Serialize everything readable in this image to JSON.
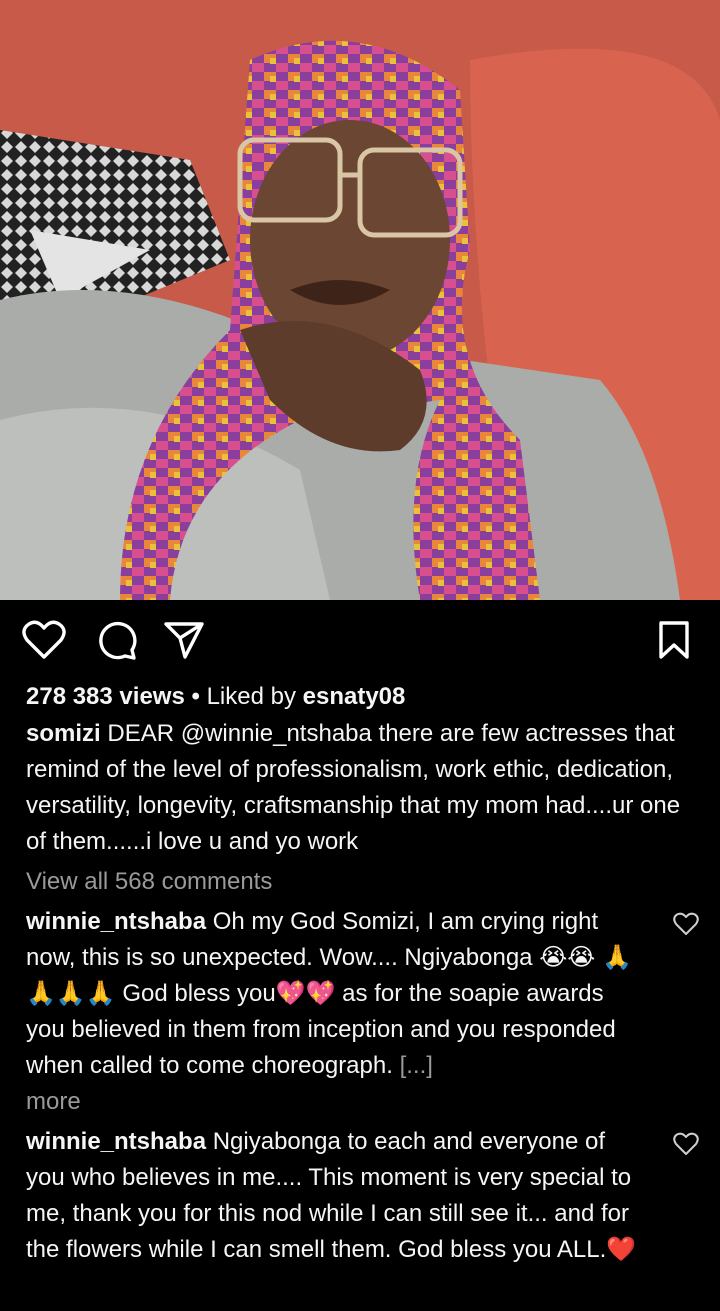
{
  "post": {
    "views": "278 383 views",
    "separator": "•",
    "liked_prefix": "Liked by",
    "liked_user": "esnaty08",
    "caption_user": "somizi",
    "caption_text": "DEAR @winnie_ntshaba there are few actresses that remind of the level of professionalism, work ethic, dedication, versatility, longevity, craftsmanship that my mom had....ur one of them......i love u and yo work",
    "view_all_comments": "View all 568 comments"
  },
  "comments": [
    {
      "user": "winnie_ntshaba",
      "text": "Oh my God Somizi, I am crying right now, this is so unexpected. Wow.... Ngiyabonga 😭😭 🙏🙏🙏🙏 God bless you💖💖 as for the soapie awards you believed in them from inception and you responded when called to come choreograph.",
      "ellipsis": "[...]",
      "more": "more"
    },
    {
      "user": "winnie_ntshaba",
      "text": "Ngiyabonga to each and everyone of you who believes in me.... This moment is very special to me, thank you for  this nod while I can still see it... and for the flowers while I can smell them. God bless you ALL.❤️"
    }
  ],
  "icons": {
    "like": "heart-icon",
    "comment": "comment-bubble-icon",
    "share": "paper-plane-icon",
    "save": "bookmark-icon",
    "comment_like": "heart-outline-icon"
  }
}
